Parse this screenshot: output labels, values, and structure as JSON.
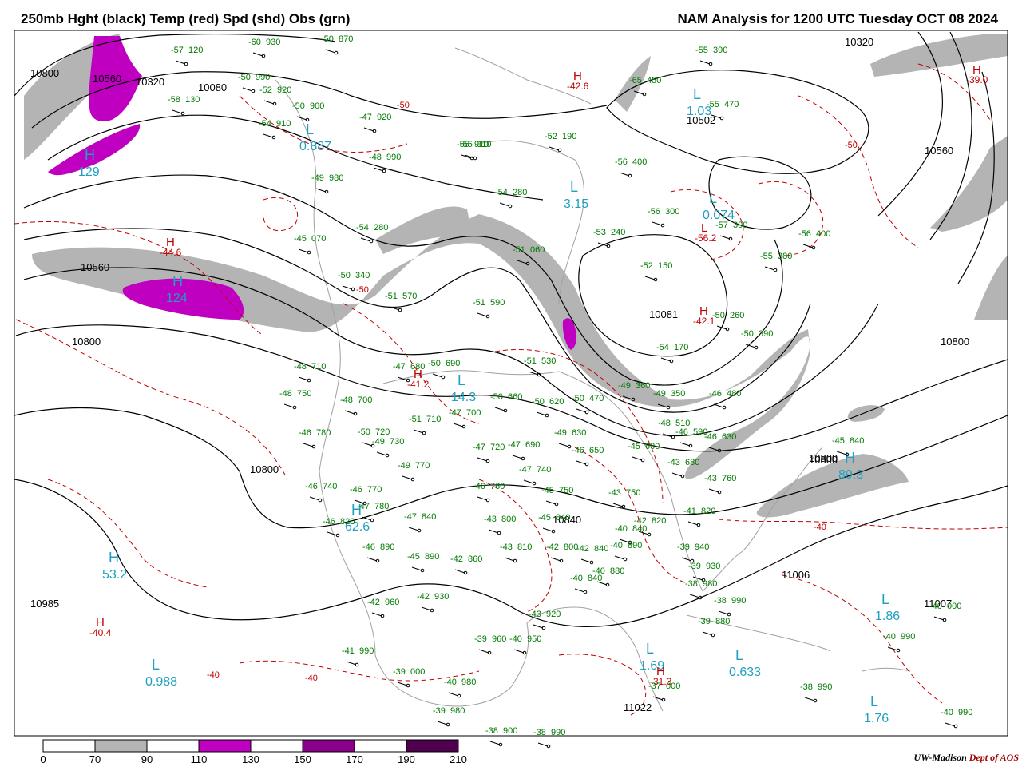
{
  "header": {
    "left_title": "250mb Hght (black) Temp (red) Spd (shd) Obs (grn)",
    "right_title": "NAM Analysis for 1200 UTC Tuesday  OCT 08 2024"
  },
  "colors": {
    "height_contour": "#000000",
    "temperature_contour": "#c00000",
    "country_border": "#a0a0a0",
    "station_obs": "#007a00",
    "speed_label": "#20a0c0",
    "wind_70_90": "#b4b4b4",
    "wind_110_130": "#c000c0",
    "wind_150_170": "#8a008a",
    "wind_190_210": "#4e004e"
  },
  "legend": {
    "ticks": [
      "0",
      "70",
      "90",
      "110",
      "130",
      "150",
      "170",
      "190",
      "210"
    ],
    "fills": [
      "#ffffff",
      "#b4b4b4",
      "#ffffff",
      "#c000c0",
      "#ffffff",
      "#8a008a",
      "#ffffff",
      "#4e004e"
    ]
  },
  "credit": {
    "org": "UW-Madison",
    "dept": "Dept of AOS"
  },
  "height_labels": [
    "10800",
    "10560",
    "10320",
    "10080",
    "10560",
    "10800",
    "10800",
    "10320",
    "10502",
    "10560",
    "10081",
    "10800",
    "10800",
    "10800",
    "10985",
    "11006",
    "11007",
    "11022",
    "10840"
  ],
  "pressure_centers": [
    {
      "letter": "H",
      "value": "53.2"
    },
    {
      "letter": "H",
      "value": "62.6"
    },
    {
      "letter": "H",
      "value": "89.3"
    },
    {
      "letter": "H",
      "value": "124"
    },
    {
      "letter": "H",
      "value": "129"
    },
    {
      "letter": "L",
      "value": "0.988"
    },
    {
      "letter": "L",
      "value": "0.887"
    },
    {
      "letter": "L",
      "value": "3.15"
    },
    {
      "letter": "L",
      "value": "0.074"
    },
    {
      "letter": "L",
      "value": "1.03"
    },
    {
      "letter": "L",
      "value": "1.86"
    },
    {
      "letter": "L",
      "value": "1.76"
    },
    {
      "letter": "L",
      "value": "0.633"
    },
    {
      "letter": "L",
      "value": "1.69"
    },
    {
      "letter": "L",
      "value": "14.3"
    }
  ],
  "temp_centers": [
    {
      "letter": "H",
      "value": "-44.6"
    },
    {
      "letter": "H",
      "value": "-40.4"
    },
    {
      "letter": "H",
      "value": "-42.6"
    },
    {
      "letter": "H",
      "value": "-42.1"
    },
    {
      "letter": "H",
      "value": "-39.0"
    },
    {
      "letter": "H",
      "value": "-31.3"
    },
    {
      "letter": "H",
      "value": "-41.2"
    },
    {
      "letter": "L",
      "value": "-56.2"
    }
  ],
  "temp_labels": [
    "-50",
    "-50",
    "-40",
    "-40",
    "-40",
    "-50"
  ],
  "station_obs": [
    {
      "t": "-57",
      "h": "120"
    },
    {
      "t": "-60",
      "h": "930"
    },
    {
      "t": "-50",
      "h": "870"
    },
    {
      "t": "-52",
      "h": "920"
    },
    {
      "t": "-50",
      "h": "990"
    },
    {
      "t": "-58",
      "h": "130"
    },
    {
      "t": "-50",
      "h": "900"
    },
    {
      "t": "-54",
      "h": "910"
    },
    {
      "t": "-47",
      "h": "920"
    },
    {
      "t": "-55",
      "h": "910"
    },
    {
      "t": "-48",
      "h": "990"
    },
    {
      "t": "-49",
      "h": "980"
    },
    {
      "t": "-45",
      "h": "070"
    },
    {
      "t": "-54",
      "h": "280"
    },
    {
      "t": "-50",
      "h": "340"
    },
    {
      "t": "-51",
      "h": "570"
    },
    {
      "t": "-51",
      "h": "590"
    },
    {
      "t": "-51",
      "h": "060"
    },
    {
      "t": "-53",
      "h": "240"
    },
    {
      "t": "-52",
      "h": "150"
    },
    {
      "t": "-56",
      "h": "300"
    },
    {
      "t": "-57",
      "h": "300"
    },
    {
      "t": "-56",
      "h": "400"
    },
    {
      "t": "-55",
      "h": "380"
    },
    {
      "t": "-55",
      "h": "390"
    },
    {
      "t": "-55",
      "h": "470"
    },
    {
      "t": "-65",
      "h": "450"
    },
    {
      "t": "-56",
      "h": "400"
    },
    {
      "t": "-54",
      "h": "280"
    },
    {
      "t": "-55",
      "h": "110"
    },
    {
      "t": "-52",
      "h": "190"
    },
    {
      "t": "-48",
      "h": "710"
    },
    {
      "t": "-47",
      "h": "680"
    },
    {
      "t": "-50",
      "h": "690"
    },
    {
      "t": "-48",
      "h": "750"
    },
    {
      "t": "-48",
      "h": "700"
    },
    {
      "t": "-47",
      "h": "700"
    },
    {
      "t": "-51",
      "h": "710"
    },
    {
      "t": "-50",
      "h": "660"
    },
    {
      "t": "-50",
      "h": "620"
    },
    {
      "t": "-51",
      "h": "530"
    },
    {
      "t": "-50",
      "h": "470"
    },
    {
      "t": "-49",
      "h": "360"
    },
    {
      "t": "-49",
      "h": "350"
    },
    {
      "t": "-50",
      "h": "390"
    },
    {
      "t": "-54",
      "h": "170"
    },
    {
      "t": "-50",
      "h": "260"
    },
    {
      "t": "-46",
      "h": "480"
    },
    {
      "t": "-45",
      "h": "840"
    },
    {
      "t": "-48",
      "h": "510"
    },
    {
      "t": "-46",
      "h": "590"
    },
    {
      "t": "-46",
      "h": "630"
    },
    {
      "t": "-45",
      "h": "600"
    },
    {
      "t": "-43",
      "h": "680"
    },
    {
      "t": "-43",
      "h": "760"
    },
    {
      "t": "-47",
      "h": "720"
    },
    {
      "t": "-47",
      "h": "690"
    },
    {
      "t": "-46",
      "h": "650"
    },
    {
      "t": "-49",
      "h": "630"
    },
    {
      "t": "-47",
      "h": "740"
    },
    {
      "t": "-46",
      "h": "760"
    },
    {
      "t": "-45",
      "h": "750"
    },
    {
      "t": "-43",
      "h": "750"
    },
    {
      "t": "-41",
      "h": "820"
    },
    {
      "t": "-42",
      "h": "820"
    },
    {
      "t": "-40",
      "h": "840"
    },
    {
      "t": "-40",
      "h": "890"
    },
    {
      "t": "-39",
      "h": "940"
    },
    {
      "t": "-39",
      "h": "930"
    },
    {
      "t": "-38",
      "h": "980"
    },
    {
      "t": "-38",
      "h": "990"
    },
    {
      "t": "-39",
      "h": "880"
    },
    {
      "t": "-40",
      "h": "880"
    },
    {
      "t": "-40",
      "h": "840"
    },
    {
      "t": "-42",
      "h": "840"
    },
    {
      "t": "-42",
      "h": "800"
    },
    {
      "t": "-43",
      "h": "810"
    },
    {
      "t": "-43",
      "h": "800"
    },
    {
      "t": "-45",
      "h": "840"
    },
    {
      "t": "-47",
      "h": "840"
    },
    {
      "t": "-47",
      "h": "780"
    },
    {
      "t": "-46",
      "h": "770"
    },
    {
      "t": "-46",
      "h": "740"
    },
    {
      "t": "-46",
      "h": "780"
    },
    {
      "t": "-50",
      "h": "720"
    },
    {
      "t": "-49",
      "h": "730"
    },
    {
      "t": "-49",
      "h": "770"
    },
    {
      "t": "-46",
      "h": "820"
    },
    {
      "t": "-46",
      "h": "890"
    },
    {
      "t": "-45",
      "h": "890"
    },
    {
      "t": "-42",
      "h": "860"
    },
    {
      "t": "-42",
      "h": "960"
    },
    {
      "t": "-42",
      "h": "930"
    },
    {
      "t": "-43",
      "h": "920"
    },
    {
      "t": "-40",
      "h": "950"
    },
    {
      "t": "-39",
      "h": "960"
    },
    {
      "t": "-41",
      "h": "990"
    },
    {
      "t": "-39",
      "h": "000"
    },
    {
      "t": "-40",
      "h": "980"
    },
    {
      "t": "-39",
      "h": "980"
    },
    {
      "t": "-38",
      "h": "900"
    },
    {
      "t": "-38",
      "h": "990"
    },
    {
      "t": "-37",
      "h": "000"
    },
    {
      "t": "-38",
      "h": "990"
    },
    {
      "t": "-40",
      "h": "990"
    },
    {
      "t": "-40",
      "h": "000"
    },
    {
      "t": "-40",
      "h": "990"
    }
  ]
}
